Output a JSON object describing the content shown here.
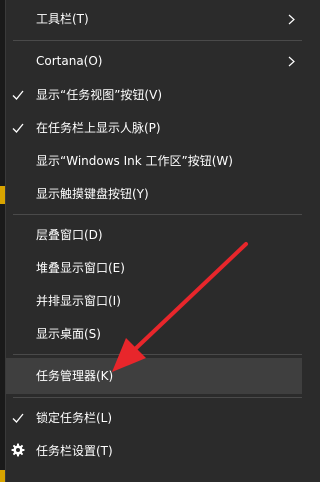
{
  "menu": {
    "items": [
      {
        "label": "工具栏(T)",
        "checked": false,
        "submenu": true
      },
      {
        "label": "Cortana(O)",
        "checked": false,
        "submenu": true
      },
      {
        "label": "显示“任务视图”按钮(V)",
        "checked": true
      },
      {
        "label": "在任务栏上显示人脉(P)",
        "checked": true
      },
      {
        "label": "显示“Windows Ink 工作区”按钮(W)",
        "checked": false
      },
      {
        "label": "显示触摸键盘按钮(Y)",
        "checked": false
      },
      {
        "label": "层叠窗口(D)",
        "checked": false
      },
      {
        "label": "堆叠显示窗口(E)",
        "checked": false
      },
      {
        "label": "并排显示窗口(I)",
        "checked": false
      },
      {
        "label": "显示桌面(S)",
        "checked": false
      },
      {
        "label": "任务管理器(K)",
        "checked": false,
        "highlighted": true
      },
      {
        "label": "锁定任务栏(L)",
        "checked": true
      },
      {
        "label": "任务栏设置(T)",
        "icon": "gear-icon"
      }
    ]
  },
  "colors": {
    "background": "#2b2b2b",
    "highlight": "#3f3f3f",
    "text": "#ffffff",
    "separator": "#4a4a4a",
    "annotation_arrow": "#e8262b"
  }
}
